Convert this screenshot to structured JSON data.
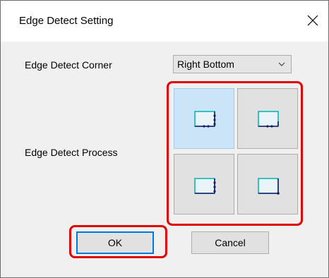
{
  "dialog": {
    "title": "Edge Detect Setting",
    "close_label": "×"
  },
  "form": {
    "corner_label": "Edge Detect Corner",
    "corner_value": "Right Bottom",
    "process_label": "Edge Detect Process"
  },
  "process_options": [
    {
      "name": "corner-with-edge-scan",
      "selected": true
    },
    {
      "name": "corner-left-scan",
      "selected": false
    },
    {
      "name": "right-edge-scan",
      "selected": false
    },
    {
      "name": "corner-point",
      "selected": false
    }
  ],
  "buttons": {
    "ok": "OK",
    "cancel": "Cancel"
  },
  "colors": {
    "highlight": "#e00000",
    "selected_tile": "#cce4f7",
    "focus_border": "#0078d7",
    "rect_fill": "#e8f4f8",
    "rect_stroke": "#00b3b3",
    "marker": "#1a1a66"
  }
}
